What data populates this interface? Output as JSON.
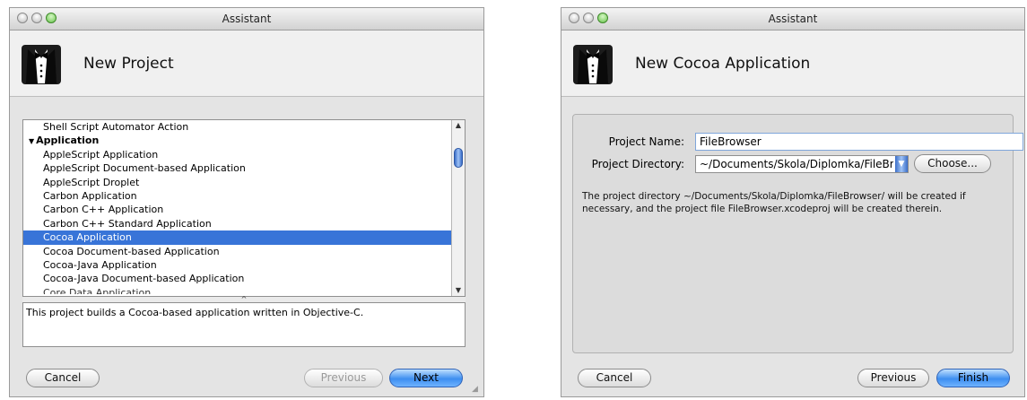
{
  "window1": {
    "title": "Assistant",
    "header_title": "New Project",
    "list_items": [
      {
        "label": "Shell Script Automator Action",
        "kind": "item"
      },
      {
        "label": "Application",
        "kind": "group"
      },
      {
        "label": "AppleScript Application",
        "kind": "item"
      },
      {
        "label": "AppleScript Document-based Application",
        "kind": "item"
      },
      {
        "label": "AppleScript Droplet",
        "kind": "item"
      },
      {
        "label": "Carbon Application",
        "kind": "item"
      },
      {
        "label": "Carbon C++ Application",
        "kind": "item"
      },
      {
        "label": "Carbon C++ Standard Application",
        "kind": "item"
      },
      {
        "label": "Cocoa Application",
        "kind": "item",
        "selected": true
      },
      {
        "label": "Cocoa Document-based Application",
        "kind": "item"
      },
      {
        "label": "Cocoa-Java Application",
        "kind": "item"
      },
      {
        "label": "Cocoa-Java Document-based Application",
        "kind": "item"
      },
      {
        "label": "Core Data Application",
        "kind": "item",
        "cut": true
      }
    ],
    "description": "This project builds a Cocoa-based application written in Objective-C.",
    "buttons": {
      "cancel": "Cancel",
      "previous": "Previous",
      "next": "Next"
    }
  },
  "window2": {
    "title": "Assistant",
    "header_title": "New Cocoa Application",
    "project_name_label": "Project Name:",
    "project_name_value": "FileBrowser",
    "project_directory_label": "Project Directory:",
    "project_directory_value": "~/Documents/Skola/Diplomka/FileBr",
    "choose_label": "Choose...",
    "info_text_1": "The project directory ~/Documents/Skola/Diplomka/FileBrowser/ will be created if",
    "info_text_2": "necessary, and the project file FileBrowser.xcodeproj will be created therein.",
    "buttons": {
      "cancel": "Cancel",
      "previous": "Previous",
      "finish": "Finish"
    }
  },
  "colors": {
    "selection": "#3874d8",
    "default_button": "#3d8ef0"
  },
  "icons": {
    "app": "tuxedo-icon",
    "disclosure": "disclosure-triangle-icon"
  }
}
